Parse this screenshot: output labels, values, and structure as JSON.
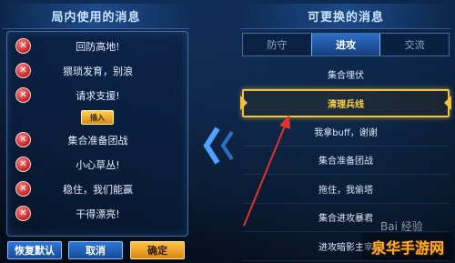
{
  "left_panel": {
    "title": "局内使用的消息",
    "items": [
      {
        "label": "回防高地!"
      },
      {
        "label": "猥琐发育，别浪"
      },
      {
        "label": "请求支援!"
      },
      {
        "label": "集合准备团战"
      },
      {
        "label": "小心草丛!"
      },
      {
        "label": "稳住，我们能赢"
      },
      {
        "label": "干得漂亮!"
      }
    ],
    "insert_label": "插入",
    "remove_icon": "close-icon"
  },
  "buttons": {
    "reset": "恢复默认",
    "cancel": "取消",
    "confirm": "确定"
  },
  "right_panel": {
    "title": "可更换的消息",
    "tabs": [
      {
        "label": "防守",
        "active": false
      },
      {
        "label": "进攻",
        "active": true
      },
      {
        "label": "交流",
        "active": false
      }
    ],
    "items": [
      {
        "label": "集合埋伏",
        "selected": false
      },
      {
        "label": "清理兵线",
        "selected": true
      },
      {
        "label": "我拿buff，谢谢",
        "selected": false
      },
      {
        "label": "集合准备团战",
        "selected": false
      },
      {
        "label": "拖住，我偷塔",
        "selected": false
      },
      {
        "label": "集合进攻暴君",
        "selected": false
      },
      {
        "label": "进攻暗影主宰",
        "selected": false
      }
    ]
  },
  "watermark": {
    "text": "泉华手游网",
    "baidu": "Bai 经验"
  },
  "colors": {
    "accent_gold": "#f2c23a",
    "remove_red": "#c11d1d",
    "annotation_arrow": "#e0332a"
  }
}
